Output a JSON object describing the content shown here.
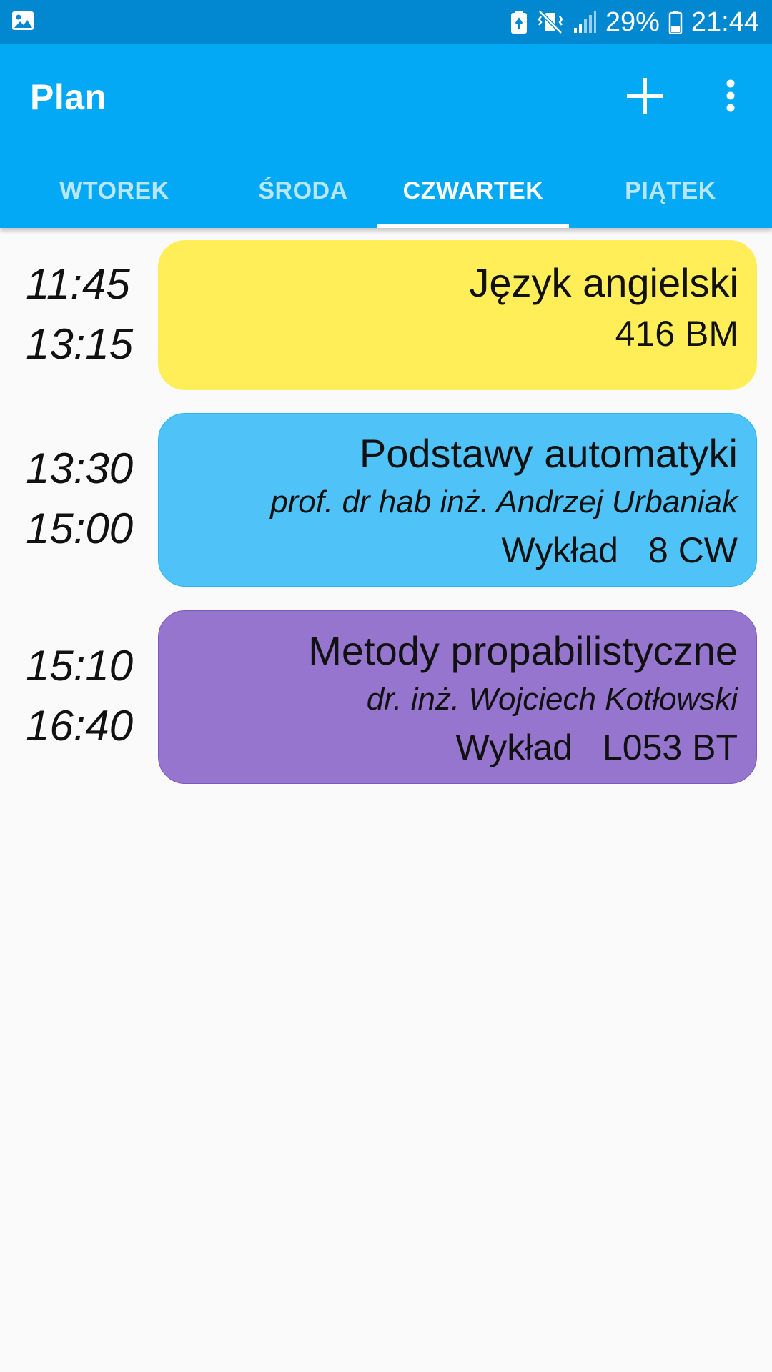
{
  "status_bar": {
    "battery_percent": "29%",
    "time": "21:44",
    "icons": [
      "image-icon",
      "battery-saver-icon",
      "vibrate-mute-icon",
      "signal-icon",
      "battery-icon"
    ]
  },
  "app_bar": {
    "title": "Plan",
    "add_icon": "plus-icon",
    "menu_icon": "more-vert-icon",
    "color": "#03a9f4"
  },
  "tabs": [
    {
      "label": "WTOREK",
      "active": false
    },
    {
      "label": "ŚRODA",
      "active": false
    },
    {
      "label": "CZWARTEK",
      "active": true
    },
    {
      "label": "PIĄTEK",
      "active": false
    }
  ],
  "lessons": [
    {
      "start": "11:45",
      "end": "13:15",
      "title": "Język angielski",
      "teacher": "",
      "type": "",
      "room": "416 BM",
      "color": "#ffee58"
    },
    {
      "start": "13:30",
      "end": "15:00",
      "title": "Podstawy automatyki",
      "teacher": "prof. dr hab inż. Andrzej Urbaniak",
      "type": "Wykład",
      "room": "8 CW",
      "color": "#4fc3f7"
    },
    {
      "start": "15:10",
      "end": "16:40",
      "title": "Metody propabilistyczne",
      "teacher": "dr. inż. Wojciech Kotłowski",
      "type": "Wykład",
      "room": "L053 BT",
      "color": "#9575cd"
    }
  ]
}
